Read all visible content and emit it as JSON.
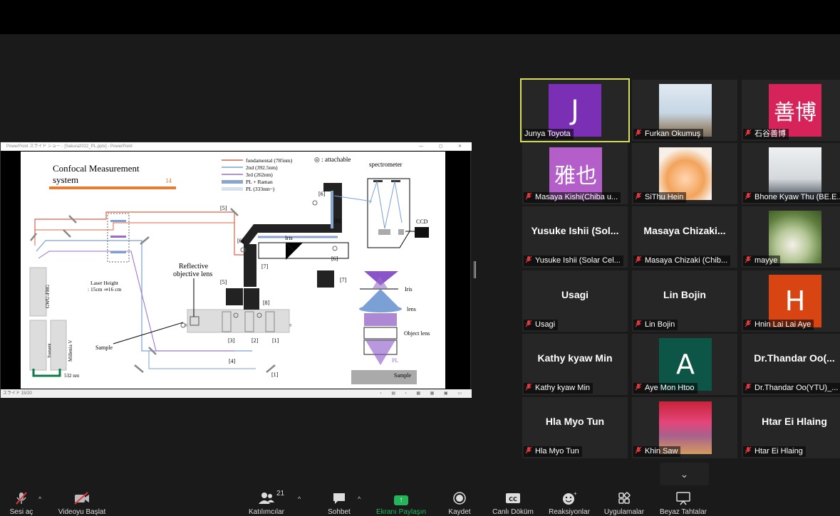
{
  "window": {
    "ppt_title": "PowerPoint スライド ショー - [Sakura2022_PL.pptx] - PowerPoint",
    "ppt_status": "スライド 15/20"
  },
  "slide": {
    "title": "Confocal Measurement system",
    "title_line1": "Confocal Measurement",
    "title_line2": "system",
    "page_number": "14",
    "legend": [
      "fundamental (785nm)",
      "2nd (392.5nm)",
      "3rd (262nm)",
      "PL + Raman",
      "PL (333nm~)"
    ],
    "legend_colors": [
      "#e0604a",
      "#7aa0d6",
      "#9a6cc8",
      "#8aa6cc",
      "#d6e0f0"
    ],
    "attachable": "◎ : attachable",
    "spectrometer": "spectrometer",
    "ccd": "CCD",
    "iris": "Iris",
    "iris2": "Iris",
    "lens": "lens",
    "object_lens": "Object lens",
    "pl": "PL",
    "sample_right": "Sample",
    "sample_left": "Sample",
    "reflective_1": "Reflective",
    "reflective_2": "objective lens",
    "laser_height_1": "Laser Height",
    "laser_height_2": ": 15cm ⇒16 cm",
    "gwu": "GWU-FHG",
    "tsunami": "Tsunami",
    "millenia": "Millenia V",
    "nm532": "532 nm",
    "labels": {
      "l5a": "[5]",
      "l6a": "[6]",
      "l6b": "[6]",
      "l6c": "[6]",
      "l8a": "[8]",
      "l8b": "[8]",
      "l7a": "[7]",
      "l7b": "[7]",
      "l5b": "[5]",
      "l3": "[3]",
      "l2": "[2]",
      "l1a": "[1]",
      "l4": "[4]",
      "l1b": "[1]"
    }
  },
  "participants": [
    {
      "name": "Junya Toyota",
      "avatar": "J",
      "color": "#7b2fb5",
      "muted": false,
      "active": true
    },
    {
      "name": "Furkan Okumuş",
      "avatar": "",
      "photo": "ph-tower",
      "muted": true
    },
    {
      "name": "石谷善博",
      "avatar": "善博",
      "color": "#d6245b",
      "muted": true
    },
    {
      "name": "Masaya Kishi(Chiba u...",
      "avatar": "雅也",
      "color": "#b45fc9",
      "muted": true
    },
    {
      "name": "SiThu Hein",
      "avatar": "",
      "photo": "ph-anime",
      "muted": true
    },
    {
      "name": "Bhone Kyaw Thu (BE.E...",
      "avatar": "",
      "photo": "ph-person",
      "muted": true
    },
    {
      "name": "Yusuke Ishii (Solar Cel...",
      "big": "Yusuke Ishii (Sol...",
      "muted": true
    },
    {
      "name": "Masaya Chizaki (Chib...",
      "big": "Masaya Chizaki...",
      "muted": true
    },
    {
      "name": "mayye",
      "avatar": "",
      "photo": "ph-garden",
      "muted": true
    },
    {
      "name": "Usagi",
      "big": "Usagi",
      "muted": true
    },
    {
      "name": "Lin Bojin",
      "big": "Lin Bojin",
      "muted": true
    },
    {
      "name": "Hnin Lai Lai Aye",
      "avatar": "H",
      "color": "#d84412",
      "muted": true
    },
    {
      "name": "Kathy kyaw Min",
      "big": "Kathy kyaw Min",
      "muted": true
    },
    {
      "name": "Aye Mon Htoo",
      "avatar": "A",
      "color": "#0d5547",
      "muted": true
    },
    {
      "name": "Dr.Thandar Oo(YTU)_...",
      "big": "Dr.Thandar Oo(...",
      "muted": true
    },
    {
      "name": "Hla Myo Tun",
      "big": "Hla Myo Tun",
      "muted": true
    },
    {
      "name": "Khin Saw",
      "avatar": "",
      "photo": "ph-event",
      "muted": true
    },
    {
      "name": "Htar Ei Hlaing",
      "big": "Htar Ei Hlaing",
      "muted": true
    }
  ],
  "toolbar": {
    "mic": "Sesi aç",
    "video": "Videoyu Başlat",
    "participants": "Katılımcılar",
    "participants_count": "21",
    "chat": "Sohbet",
    "share": "Ekranı Paylaşın",
    "record": "Kaydet",
    "cc": "Canlı Döküm",
    "reactions": "Reaksiyonlar",
    "apps": "Uygulamalar",
    "whiteboard": "Beyaz Tahtalar"
  },
  "icons": {
    "mic": "mic-muted-icon",
    "video": "video-off-icon",
    "participants": "people-icon",
    "chat": "chat-icon",
    "share": "share-screen-icon",
    "record": "record-icon",
    "cc": "cc-icon",
    "reactions": "emoji-icon",
    "apps": "apps-icon",
    "whiteboard": "whiteboard-icon"
  }
}
